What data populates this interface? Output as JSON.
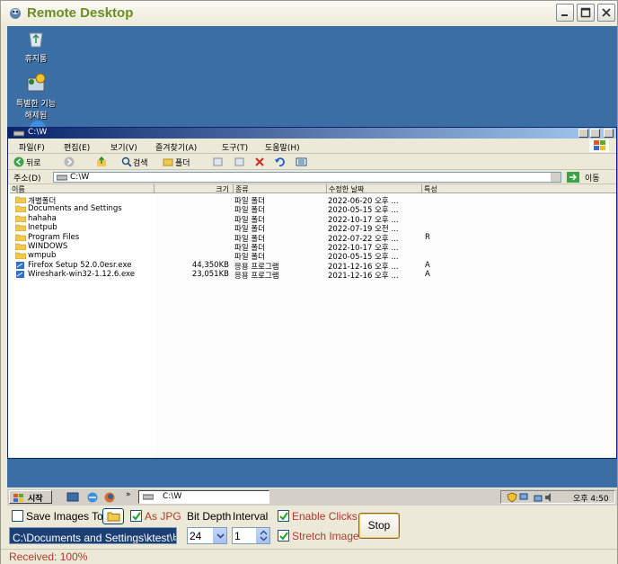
{
  "window": {
    "title": "Remote Desktop",
    "title_color": "#6b8e23"
  },
  "desktop": {
    "background_color": "#3a6ea5",
    "icons": [
      {
        "icon": "recycle-bin-icon",
        "label": "휴지통"
      },
      {
        "icon": "shortcut-icon",
        "label": "특별한 기능\n해제됨"
      }
    ]
  },
  "explorer": {
    "title": "C:\\W",
    "menu": [
      "파일(F)",
      "편집(E)",
      "보기(V)",
      "즐겨찾기(A)",
      "도구(T)",
      "도움말(H)"
    ],
    "toolbar": {
      "back": "뒤로",
      "search": "검색",
      "folders": "폴더"
    },
    "address_label": "주소(D)",
    "address_value": "C:\\W",
    "go_label": "이동",
    "columns": [
      "이름",
      "크기",
      "종류",
      "수정한 날짜",
      "특성"
    ],
    "rows": [
      {
        "name": "개별폴더",
        "size": "",
        "type": "파일 폴더",
        "date": "2022-06-20 오후 ...",
        "attr": ""
      },
      {
        "name": "Documents and Settings",
        "size": "",
        "type": "파일 폴더",
        "date": "2020-05-15 오후 ...",
        "attr": ""
      },
      {
        "name": "hahaha",
        "size": "",
        "type": "파일 폴더",
        "date": "2022-10-17 오후 ...",
        "attr": ""
      },
      {
        "name": "Inetpub",
        "size": "",
        "type": "파일 폴더",
        "date": "2022-07-19 오전 ...",
        "attr": ""
      },
      {
        "name": "Program Files",
        "size": "",
        "type": "파일 폴더",
        "date": "2022-07-22 오후 ...",
        "attr": "R"
      },
      {
        "name": "WINDOWS",
        "size": "",
        "type": "파일 폴더",
        "date": "2022-10-17 오후 ...",
        "attr": ""
      },
      {
        "name": "wmpub",
        "size": "",
        "type": "파일 폴더",
        "date": "2020-05-15 오후 ...",
        "attr": ""
      },
      {
        "name": "Firefox Setup 52.0.0esr.exe",
        "size": "44,350KB",
        "type": "응용 프로그램",
        "date": "2021-12-16 오후 ...",
        "attr": "A"
      },
      {
        "name": "Wireshark-win32-1.12.6.exe",
        "size": "23,051KB",
        "type": "응용 프로그램",
        "date": "2021-12-16 오후 ...",
        "attr": "A"
      }
    ]
  },
  "taskbar": {
    "start_label": "시작",
    "task_label": "C:\\W",
    "clock": "오후 4:50"
  },
  "controls": {
    "save_images_label": "Save Images To",
    "save_images_checked": false,
    "as_jpg_label": "As JPG",
    "as_jpg_checked": true,
    "bit_depth_label": "Bit Depth",
    "bit_depth_value": "24",
    "interval_label": "Interval",
    "interval_value": "1",
    "enable_clicks_label": "Enable Clicks",
    "enable_clicks_checked": true,
    "stretch_image_label": "Stretch Image",
    "stretch_image_checked": true,
    "path_value": "C:\\Documents and Settings\\ktest\\바탕",
    "stop_label": "Stop"
  },
  "status": {
    "text": "Received: 100%",
    "color": "#b03a2e"
  }
}
